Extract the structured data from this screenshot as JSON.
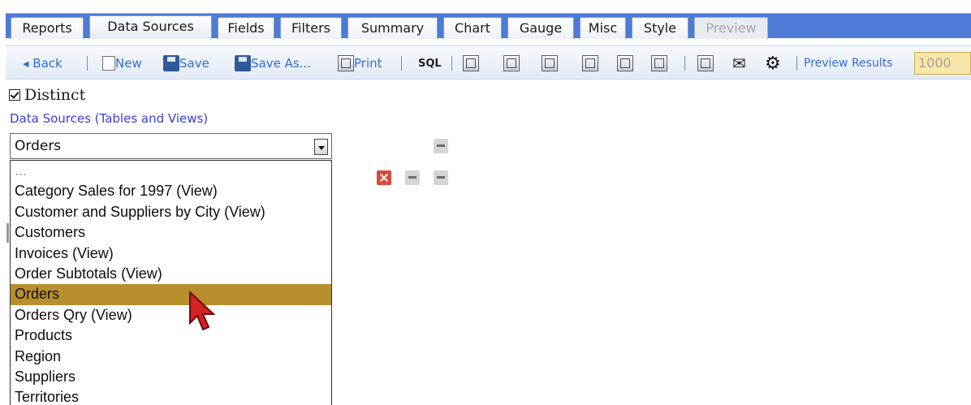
{
  "tabs": [
    {
      "label": "Reports",
      "state": "normal"
    },
    {
      "label": "Data Sources",
      "state": "active"
    },
    {
      "label": "Fields",
      "state": "normal"
    },
    {
      "label": "Filters",
      "state": "normal"
    },
    {
      "label": "Summary",
      "state": "normal"
    },
    {
      "label": "Chart",
      "state": "normal"
    },
    {
      "label": "Gauge",
      "state": "normal"
    },
    {
      "label": "Misc",
      "state": "normal"
    },
    {
      "label": "Style",
      "state": "normal"
    },
    {
      "label": "Preview",
      "state": "disabled"
    }
  ],
  "toolbar": {
    "back_label": "◂ Back",
    "new_label": "New",
    "save_label": "Save",
    "save_as_label": "Save As...",
    "print_label": "Print",
    "sql_label": "SQL",
    "preview_results_label": "Preview Results",
    "preview_results_value": "1000",
    "icons": [
      "back-arrow-icon",
      "new-document-icon",
      "save-disk-icon",
      "save-as-disk-icon",
      "pdf-print-icon",
      "sql-icon",
      "excel-export-icon",
      "csv-export-icon",
      "word-export-icon",
      "text-export-icon",
      "edit-icon",
      "rtf-export-icon",
      "grid-icon",
      "email-icon",
      "settings-gear-icon"
    ]
  },
  "distinct": {
    "label": "Distinct",
    "checked": true
  },
  "data_sources": {
    "section_label": "Data Sources (Tables and Views)",
    "selected": "Orders",
    "options": [
      "...",
      "Category Sales for 1997 (View)",
      "Customer and Suppliers by City (View)",
      "Customers",
      "Invoices (View)",
      "Order Subtotals (View)",
      "Orders",
      "Orders Qry (View)",
      "Products",
      "Region",
      "Suppliers",
      "Territories"
    ],
    "highlighted_index": 6
  },
  "colors": {
    "tab_strip": "#4d7bd6",
    "toolbar_text": "#2d6ed1",
    "section_label": "#3b3be0",
    "selection_highlight": "#b88f2f",
    "remove_button": "#d9493a"
  }
}
